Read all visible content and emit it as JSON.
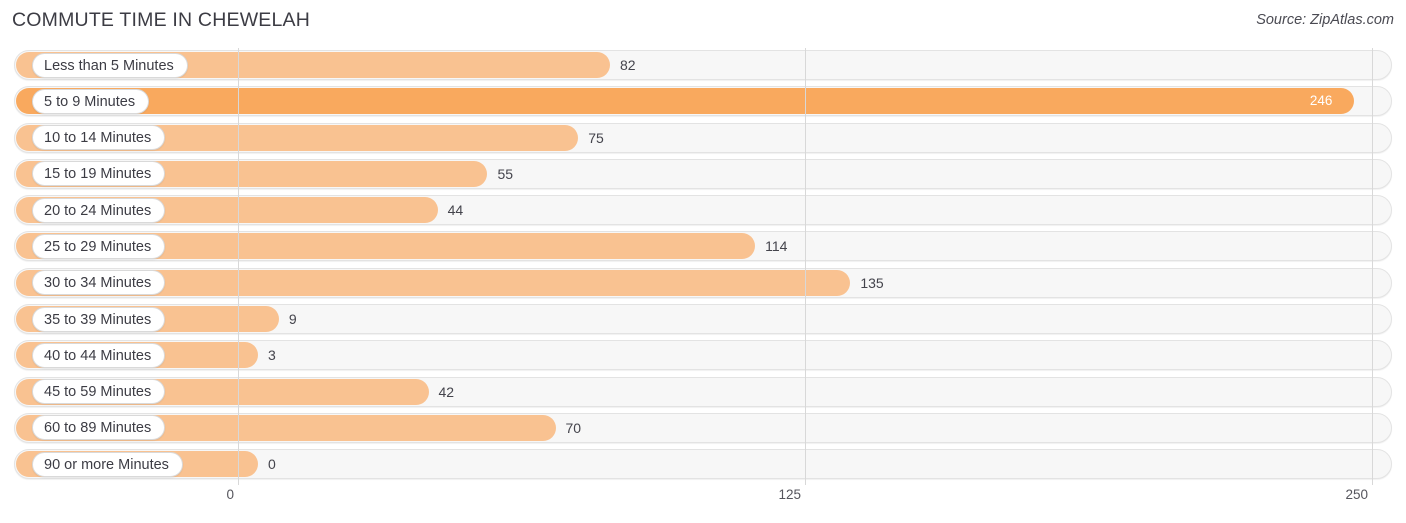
{
  "header": {
    "title": "COMMUTE TIME IN CHEWELAH",
    "source": "Source: ZipAtlas.com"
  },
  "colors": {
    "bar_normal": "#f9c291",
    "bar_highlight": "#f9a95e",
    "track": "#f7f7f7",
    "gridline": "#d8d8d8",
    "text": "#3c3c44"
  },
  "chart_data": {
    "type": "bar",
    "orientation": "horizontal",
    "title": "COMMUTE TIME IN CHEWELAH",
    "xlabel": "",
    "ylabel": "",
    "xlim": [
      0,
      250
    ],
    "ticks": [
      0,
      125,
      250
    ],
    "tick_labels": [
      "0",
      "125",
      "250"
    ],
    "grid": true,
    "legend": false,
    "highlight_index": 1,
    "categories": [
      "Less than 5 Minutes",
      "5 to 9 Minutes",
      "10 to 14 Minutes",
      "15 to 19 Minutes",
      "20 to 24 Minutes",
      "25 to 29 Minutes",
      "30 to 34 Minutes",
      "35 to 39 Minutes",
      "40 to 44 Minutes",
      "45 to 59 Minutes",
      "60 to 89 Minutes",
      "90 or more Minutes"
    ],
    "values": [
      82,
      246,
      75,
      55,
      44,
      114,
      135,
      9,
      3,
      42,
      70,
      0
    ],
    "value_labels": [
      "82",
      "246",
      "75",
      "55",
      "44",
      "114",
      "135",
      "9",
      "3",
      "42",
      "70",
      "0"
    ]
  }
}
